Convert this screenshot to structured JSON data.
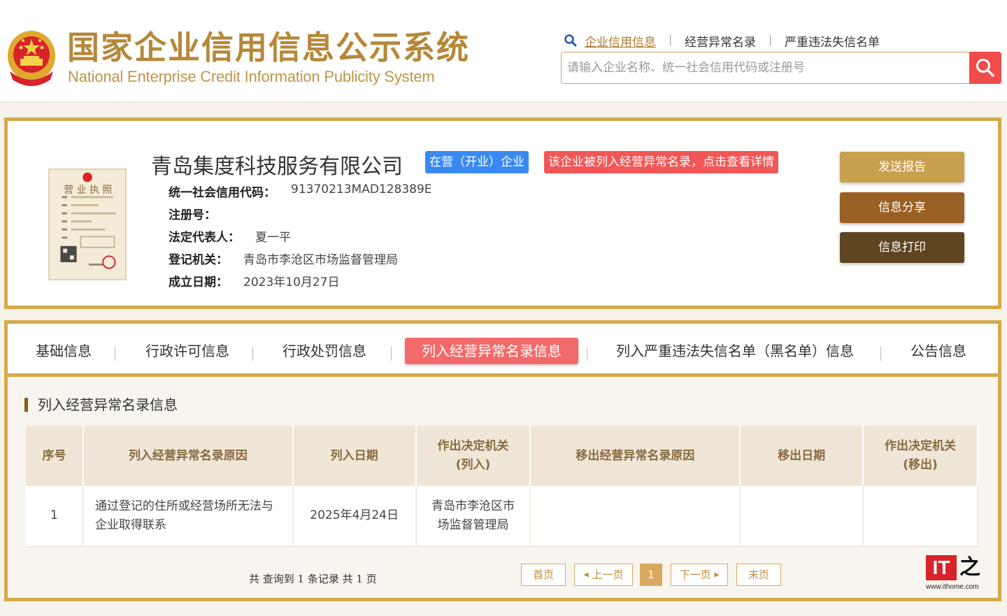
{
  "header": {
    "title": "国家企业信用信息公示系统",
    "subtitle": "National Enterprise Credit Information Publicity System",
    "nav": [
      "企业信用信息",
      "经营异常名录",
      "严重违法失信名单"
    ],
    "search_placeholder": "请输入企业名称、统一社会信用代码或注册号"
  },
  "company": {
    "name": "青岛集度科技服务有限公司",
    "status_badge": "在营（开业）企业",
    "alert_badge": "该企业被列入经营异常名录，点击查看详情",
    "license_label": "营 业 执 照",
    "fields": [
      {
        "label": "统一社会信用代码：",
        "value": "91370213MAD128389E"
      },
      {
        "label": "注册号：",
        "value": ""
      },
      {
        "label": "法定代表人：",
        "value": "夏一平"
      },
      {
        "label": "登记机关：",
        "value": "青岛市李沧区市场监督管理局"
      },
      {
        "label": "成立日期：",
        "value": "2023年10月27日"
      }
    ],
    "actions": [
      "发送报告",
      "信息分享",
      "信息打印"
    ],
    "action_colors": [
      "#c9a04e",
      "#9a5f22",
      "#5e4420"
    ]
  },
  "tabs": [
    "基础信息",
    "行政许可信息",
    "行政处罚信息",
    "列入经营异常名录信息",
    "列入严重违法失信名单（黑名单）信息",
    "公告信息"
  ],
  "active_tab": 3,
  "section": {
    "title": "列入经营异常名录信息",
    "columns": [
      "序号",
      "列入经营异常名录原因",
      "列入日期",
      "作出决定机关（列入）",
      "移出经营异常名录原因",
      "移出日期",
      "作出决定机关（移出）"
    ],
    "column_lines": [
      [
        "序号"
      ],
      [
        "列入经营异常名录原因"
      ],
      [
        "列入日期"
      ],
      [
        "作出决定机关",
        "(列入)"
      ],
      [
        "移出经营异常名录原因"
      ],
      [
        "移出日期"
      ],
      [
        "作出决定机关",
        "(移出)"
      ]
    ],
    "rows": [
      [
        [
          "1"
        ],
        [
          "通过登记的住所或经营场所无法与",
          "企业取得联系"
        ],
        [
          "2025年4月24日"
        ],
        [
          "青岛市李沧区市",
          "场监督管理局"
        ],
        [
          ""
        ],
        [
          ""
        ],
        [
          ""
        ]
      ]
    ]
  },
  "pagination": {
    "info": "共 查询到 1 条记录 共 1 页",
    "first": "首页",
    "prev": "上一页",
    "current": "1",
    "next": "下一页",
    "last": "末页"
  },
  "watermark": {
    "brand": "IT之家",
    "url": "www.ithome.com"
  },
  "colors": {
    "gold": "#d4a94a",
    "red": "#f04c4c",
    "blue": "#3a89f2"
  }
}
